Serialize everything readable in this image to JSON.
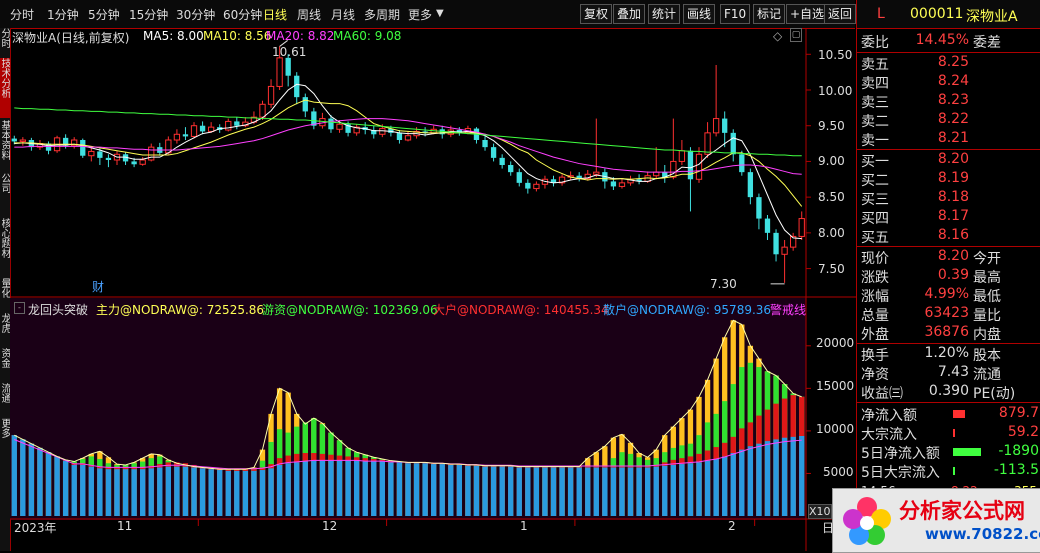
{
  "period_tabs": [
    "分时",
    "1分钟",
    "5分钟",
    "15分钟",
    "30分钟",
    "60分钟",
    "日线",
    "周线",
    "月线",
    "多周期",
    "更多"
  ],
  "active_period": "日线",
  "tools": [
    "复权",
    "叠加",
    "统计",
    "画线",
    "F10",
    "标记",
    "+自选",
    "返回"
  ],
  "left_tabs": [
    "分时",
    "技术分析",
    "基本资料",
    "公司",
    "核心题材",
    "量化",
    "龙虎",
    "资金",
    "流通",
    "更多"
  ],
  "chart_header": {
    "stock": "深物业A(日线,前复权)",
    "ma5": "MA5: 8.00",
    "ma10": "MA10: 8.56",
    "ma20": "MA20: 8.82",
    "ma60": "MA60: 9.08"
  },
  "annotations": {
    "high": "10.61",
    "low": "7.30",
    "cai": "财"
  },
  "indicator_header": {
    "name": "龙回头突破",
    "zhuli": "主力@NODRAW@: 72525.86",
    "youzi": "游资@NODRAW@: 102369.06",
    "dahu": "大户@NODRAW@: 140455.34",
    "sanhu": "散户@NODRAW@: 95789.36",
    "jingjie": "警戒线"
  },
  "price_axis": [
    "10.50",
    "10.00",
    "9.50",
    "9.00",
    "8.50",
    "8.00",
    "7.50"
  ],
  "vol_axis": [
    "20000",
    "15000",
    "10000",
    "5000"
  ],
  "x_axis": [
    "2023年",
    "11",
    "12",
    "1",
    "2"
  ],
  "x10": "X10",
  "ri": "日",
  "sidebar": {
    "code": "000011",
    "name": "深物业A",
    "flag": "L",
    "weibi_label": "委比",
    "weibi_value": "14.45%",
    "weicha_label": "委差",
    "sells": [
      {
        "label": "卖五",
        "price": "8.25"
      },
      {
        "label": "卖四",
        "price": "8.24"
      },
      {
        "label": "卖三",
        "price": "8.23"
      },
      {
        "label": "卖二",
        "price": "8.22"
      },
      {
        "label": "卖一",
        "price": "8.21"
      }
    ],
    "buys": [
      {
        "label": "买一",
        "price": "8.20"
      },
      {
        "label": "买二",
        "price": "8.19"
      },
      {
        "label": "买三",
        "price": "8.18"
      },
      {
        "label": "买四",
        "price": "8.17"
      },
      {
        "label": "买五",
        "price": "8.16"
      }
    ],
    "quote": [
      {
        "label": "现价",
        "value": "8.20",
        "label2": "今开"
      },
      {
        "label": "涨跌",
        "value": "0.39",
        "label2": "最高"
      },
      {
        "label": "涨幅",
        "value": "4.99%",
        "label2": "最低"
      },
      {
        "label": "总量",
        "value": "63423",
        "label2": "量比"
      },
      {
        "label": "外盘",
        "value": "36876",
        "label2": "内盘"
      }
    ],
    "stats": [
      {
        "label": "换手",
        "value": "1.20%",
        "label2": "股本"
      },
      {
        "label": "净资",
        "value": "7.43",
        "label2": "流通"
      },
      {
        "label": "收益㈢",
        "value": "0.390",
        "label2": "PE(动)"
      }
    ],
    "flows": [
      {
        "label": "净流入额",
        "value": "879.7"
      },
      {
        "label": "大宗流入",
        "value": "59.2"
      },
      {
        "label": "5日净流入额",
        "value": "-1890"
      },
      {
        "label": "5日大宗流入",
        "value": "-113.5"
      }
    ],
    "tick": {
      "time": "14:56",
      "price": "8.22",
      "vol": "355"
    }
  },
  "watermark": {
    "text": "分析家公式网",
    "url": "www.70822.com"
  },
  "chart_data": {
    "type": "candlestick",
    "price_ylim": [
      7.2,
      10.7
    ],
    "indicator_ylim": [
      0,
      23500
    ],
    "candles": [
      [
        9.32,
        9.28,
        9.36,
        9.24
      ],
      [
        9.28,
        9.3,
        9.34,
        9.22
      ],
      [
        9.3,
        9.2,
        9.33,
        9.15
      ],
      [
        9.2,
        9.25,
        9.3,
        9.16
      ],
      [
        9.25,
        9.15,
        9.28,
        9.1
      ],
      [
        9.15,
        9.33,
        9.36,
        9.12
      ],
      [
        9.33,
        9.22,
        9.38,
        9.18
      ],
      [
        9.22,
        9.3,
        9.34,
        9.18
      ],
      [
        9.3,
        9.08,
        9.32,
        9.05
      ],
      [
        9.08,
        9.14,
        9.2,
        9.0
      ],
      [
        9.14,
        9.05,
        9.18,
        8.95
      ],
      [
        9.05,
        9.02,
        9.1,
        8.92
      ],
      [
        9.02,
        9.1,
        9.15,
        8.95
      ],
      [
        9.1,
        9.0,
        9.13,
        8.95
      ],
      [
        9.0,
        8.96,
        9.05,
        8.92
      ],
      [
        8.96,
        9.02,
        9.06,
        8.94
      ],
      [
        9.02,
        9.2,
        9.25,
        9.0
      ],
      [
        9.2,
        9.12,
        9.26,
        9.08
      ],
      [
        9.12,
        9.3,
        9.35,
        9.1
      ],
      [
        9.3,
        9.38,
        9.45,
        9.25
      ],
      [
        9.38,
        9.35,
        9.48,
        9.3
      ],
      [
        9.35,
        9.5,
        9.55,
        9.32
      ],
      [
        9.5,
        9.42,
        9.56,
        9.38
      ],
      [
        9.42,
        9.48,
        9.55,
        9.4
      ],
      [
        9.48,
        9.44,
        9.52,
        9.4
      ],
      [
        9.44,
        9.56,
        9.6,
        9.42
      ],
      [
        9.56,
        9.5,
        9.62,
        9.45
      ],
      [
        9.5,
        9.55,
        9.62,
        9.48
      ],
      [
        9.55,
        9.62,
        9.7,
        9.52
      ],
      [
        9.62,
        9.8,
        9.85,
        9.58
      ],
      [
        9.8,
        10.05,
        10.15,
        9.75
      ],
      [
        10.05,
        10.45,
        10.61,
        10.0
      ],
      [
        10.45,
        10.2,
        10.5,
        10.05
      ],
      [
        10.2,
        9.9,
        10.25,
        9.8
      ],
      [
        9.9,
        9.7,
        9.95,
        9.62
      ],
      [
        9.7,
        9.5,
        9.75,
        9.45
      ],
      [
        9.5,
        9.6,
        9.68,
        9.46
      ],
      [
        9.6,
        9.45,
        9.65,
        9.4
      ],
      [
        9.45,
        9.52,
        9.58,
        9.4
      ],
      [
        9.52,
        9.4,
        9.56,
        9.35
      ],
      [
        9.4,
        9.48,
        9.52,
        9.36
      ],
      [
        9.48,
        9.44,
        9.55,
        9.38
      ],
      [
        9.44,
        9.38,
        9.5,
        9.32
      ],
      [
        9.38,
        9.46,
        9.52,
        9.34
      ],
      [
        9.46,
        9.4,
        9.5,
        9.35
      ],
      [
        9.4,
        9.3,
        9.44,
        9.25
      ],
      [
        9.3,
        9.36,
        9.42,
        9.28
      ],
      [
        9.36,
        9.42,
        9.48,
        9.32
      ],
      [
        9.42,
        9.4,
        9.48,
        9.35
      ],
      [
        9.4,
        9.45,
        9.5,
        9.38
      ],
      [
        9.45,
        9.38,
        9.5,
        9.32
      ],
      [
        9.38,
        9.44,
        9.5,
        9.34
      ],
      [
        9.44,
        9.4,
        9.48,
        9.36
      ],
      [
        9.4,
        9.46,
        9.5,
        9.38
      ],
      [
        9.46,
        9.3,
        9.48,
        9.25
      ],
      [
        9.3,
        9.2,
        9.35,
        9.15
      ],
      [
        9.2,
        9.05,
        9.25,
        9.0
      ],
      [
        9.05,
        8.95,
        9.1,
        8.9
      ],
      [
        8.95,
        8.85,
        9.0,
        8.8
      ],
      [
        8.85,
        8.7,
        8.9,
        8.65
      ],
      [
        8.7,
        8.62,
        8.75,
        8.55
      ],
      [
        8.62,
        8.68,
        8.72,
        8.58
      ],
      [
        8.68,
        8.75,
        8.8,
        8.62
      ],
      [
        8.75,
        8.7,
        8.8,
        8.65
      ],
      [
        8.7,
        8.78,
        8.82,
        8.66
      ],
      [
        8.78,
        8.8,
        8.86,
        8.74
      ],
      [
        8.8,
        8.76,
        8.85,
        8.72
      ],
      [
        8.76,
        8.82,
        8.88,
        8.73
      ],
      [
        8.82,
        8.85,
        9.6,
        8.78
      ],
      [
        8.85,
        8.72,
        8.9,
        8.62
      ],
      [
        8.72,
        8.65,
        8.78,
        8.6
      ],
      [
        8.65,
        8.7,
        8.76,
        8.62
      ],
      [
        8.7,
        8.75,
        8.8,
        8.66
      ],
      [
        8.75,
        8.72,
        8.82,
        8.68
      ],
      [
        8.72,
        8.8,
        8.86,
        8.7
      ],
      [
        8.8,
        8.85,
        9.2,
        8.76
      ],
      [
        8.85,
        8.78,
        8.95,
        8.7
      ],
      [
        8.78,
        9.0,
        9.6,
        8.75
      ],
      [
        9.0,
        9.15,
        9.3,
        8.95
      ],
      [
        9.15,
        8.75,
        9.2,
        8.3
      ],
      [
        8.75,
        9.1,
        9.2,
        8.7
      ],
      [
        9.1,
        9.4,
        9.55,
        9.05
      ],
      [
        9.4,
        9.6,
        10.35,
        9.35
      ],
      [
        9.6,
        9.4,
        9.7,
        9.2
      ],
      [
        9.4,
        9.1,
        9.45,
        9.0
      ],
      [
        9.1,
        8.85,
        9.15,
        8.8
      ],
      [
        8.85,
        8.5,
        8.9,
        8.4
      ],
      [
        8.5,
        8.2,
        8.55,
        8.05
      ],
      [
        8.2,
        8.0,
        8.25,
        7.9
      ],
      [
        8.0,
        7.7,
        8.05,
        7.6
      ],
      [
        7.7,
        7.8,
        7.9,
        7.3
      ],
      [
        7.8,
        7.95,
        8.0,
        7.75
      ],
      [
        7.95,
        8.2,
        8.3,
        7.9
      ]
    ],
    "ma5": [
      9.25,
      9.26,
      9.25,
      9.24,
      9.22,
      9.23,
      9.23,
      9.24,
      9.22,
      9.19,
      9.16,
      9.12,
      9.06,
      9.06,
      9.03,
      9.03,
      9.06,
      9.06,
      9.12,
      9.2,
      9.27,
      9.33,
      9.39,
      9.41,
      9.46,
      9.47,
      9.49,
      9.51,
      9.55,
      9.61,
      9.71,
      9.86,
      10.0,
      10.08,
      10.06,
      9.95,
      9.78,
      9.63,
      9.55,
      9.5,
      9.47,
      9.46,
      9.43,
      9.43,
      9.42,
      9.4,
      9.39,
      9.39,
      9.37,
      9.39,
      9.4,
      9.42,
      9.41,
      9.42,
      9.4,
      9.36,
      9.29,
      9.19,
      9.07,
      8.95,
      8.83,
      8.76,
      8.72,
      8.7,
      8.71,
      8.74,
      8.76,
      8.77,
      8.81,
      8.79,
      8.76,
      8.76,
      8.74,
      8.72,
      8.72,
      8.76,
      8.78,
      8.83,
      8.92,
      8.91,
      8.96,
      9.08,
      9.16,
      9.25,
      9.33,
      9.29,
      9.09,
      8.81,
      8.53,
      8.25,
      8.04,
      7.93,
      7.92
    ],
    "ma10": [
      9.26,
      9.26,
      9.26,
      9.25,
      9.24,
      9.24,
      9.24,
      9.24,
      9.23,
      9.21,
      9.19,
      9.17,
      9.15,
      9.13,
      9.11,
      9.09,
      9.09,
      9.09,
      9.09,
      9.11,
      9.15,
      9.19,
      9.23,
      9.27,
      9.32,
      9.37,
      9.41,
      9.45,
      9.48,
      9.53,
      9.59,
      9.67,
      9.75,
      9.81,
      9.86,
      9.83,
      9.82,
      9.81,
      9.81,
      9.78,
      9.71,
      9.62,
      9.53,
      9.49,
      9.46,
      9.43,
      9.42,
      9.41,
      9.4,
      9.4,
      9.4,
      9.4,
      9.4,
      9.4,
      9.4,
      9.38,
      9.35,
      9.3,
      9.24,
      9.17,
      9.12,
      9.02,
      8.95,
      8.88,
      8.83,
      8.78,
      8.76,
      8.74,
      8.76,
      8.76,
      8.75,
      8.76,
      8.75,
      8.76,
      8.77,
      8.76,
      8.77,
      8.79,
      8.82,
      8.82,
      8.86,
      8.92,
      8.99,
      9.05,
      9.12,
      9.12,
      9.08,
      9.0,
      8.89,
      8.79,
      8.67,
      8.52,
      8.37
    ],
    "ma20": [
      9.2,
      9.2,
      9.21,
      9.21,
      9.21,
      9.21,
      9.21,
      9.21,
      9.21,
      9.2,
      9.2,
      9.19,
      9.19,
      9.18,
      9.17,
      9.17,
      9.16,
      9.16,
      9.16,
      9.16,
      9.17,
      9.18,
      9.19,
      9.2,
      9.21,
      9.23,
      9.25,
      9.27,
      9.29,
      9.32,
      9.36,
      9.4,
      9.44,
      9.47,
      9.5,
      9.52,
      9.54,
      9.56,
      9.57,
      9.58,
      9.59,
      9.6,
      9.6,
      9.6,
      9.59,
      9.58,
      9.57,
      9.55,
      9.53,
      9.51,
      9.49,
      9.47,
      9.45,
      9.43,
      9.41,
      9.38,
      9.35,
      9.31,
      9.27,
      9.22,
      9.18,
      9.14,
      9.1,
      9.06,
      9.03,
      9.0,
      8.97,
      8.95,
      8.93,
      8.91,
      8.89,
      8.88,
      8.87,
      8.86,
      8.85,
      8.85,
      8.85,
      8.85,
      8.86,
      8.86,
      8.87,
      8.88,
      8.9,
      8.92,
      8.94,
      8.95,
      8.95,
      8.94,
      8.92,
      8.89,
      8.86,
      8.83,
      8.82
    ],
    "ma60": [
      9.75,
      9.74,
      9.74,
      9.73,
      9.73,
      9.72,
      9.72,
      9.71,
      9.71,
      9.7,
      9.7,
      9.69,
      9.69,
      9.68,
      9.68,
      9.67,
      9.67,
      9.66,
      9.66,
      9.65,
      9.65,
      9.64,
      9.64,
      9.63,
      9.63,
      9.62,
      9.62,
      9.61,
      9.61,
      9.6,
      9.6,
      9.59,
      9.59,
      9.58,
      9.58,
      9.57,
      9.56,
      9.55,
      9.54,
      9.53,
      9.52,
      9.51,
      9.5,
      9.49,
      9.48,
      9.47,
      9.46,
      9.45,
      9.44,
      9.43,
      9.42,
      9.41,
      9.4,
      9.39,
      9.38,
      9.37,
      9.36,
      9.35,
      9.34,
      9.33,
      9.32,
      9.31,
      9.3,
      9.29,
      9.28,
      9.27,
      9.26,
      9.25,
      9.24,
      9.23,
      9.22,
      9.21,
      9.2,
      9.19,
      9.18,
      9.17,
      9.16,
      9.16,
      9.15,
      9.14,
      9.14,
      9.13,
      9.13,
      9.12,
      9.12,
      9.11,
      9.11,
      9.1,
      9.1,
      9.09,
      9.09,
      9.08,
      9.08
    ],
    "blue": [
      9500,
      9000,
      8500,
      8000,
      7500,
      7000,
      6500,
      6000,
      6000,
      5800,
      5600,
      5500,
      5500,
      5500,
      5500,
      5500,
      5600,
      5700,
      5800,
      5800,
      5800,
      5700,
      5600,
      5500,
      5400,
      5300,
      5300,
      5300,
      5300,
      5400,
      5600,
      6000,
      6200,
      6300,
      6400,
      6500,
      6500,
      6500,
      6500,
      6500,
      6500,
      6400,
      6400,
      6400,
      6300,
      6300,
      6200,
      6200,
      6200,
      6100,
      6100,
      6000,
      6000,
      5900,
      5900,
      5800,
      5800,
      5800,
      5800,
      5700,
      5700,
      5700,
      5700,
      5700,
      5700,
      5700,
      5700,
      5700,
      5700,
      5700,
      5700,
      5700,
      5700,
      5700,
      5700,
      5800,
      5900,
      6000,
      6100,
      6200,
      6300,
      6500,
      6700,
      7000,
      7400,
      7800,
      8200,
      8500,
      8800,
      9000,
      9200,
      9300,
      9400
    ],
    "red": [
      9500,
      9000,
      8500,
      8000,
      7500,
      7000,
      6600,
      6200,
      6200,
      6000,
      5800,
      5700,
      5700,
      5700,
      5700,
      5700,
      5900,
      6100,
      6300,
      6300,
      6200,
      6000,
      5800,
      5700,
      5600,
      5500,
      5500,
      5500,
      5500,
      5700,
      6100,
      6800,
      7100,
      7300,
      7400,
      7400,
      7300,
      7200,
      7100,
      7000,
      6900,
      6800,
      6700,
      6600,
      6500,
      6400,
      6300,
      6300,
      6300,
      6200,
      6200,
      6100,
      6100,
      6000,
      6000,
      5900,
      5900,
      5900,
      5900,
      5800,
      5800,
      5800,
      5800,
      5800,
      5800,
      5800,
      5800,
      5800,
      5800,
      5800,
      5800,
      5800,
      5800,
      5800,
      5800,
      6000,
      6300,
      6600,
      6800,
      7000,
      7300,
      7700,
      8100,
      8600,
      9300,
      10300,
      11000,
      11800,
      12500,
      13200,
      13800,
      14200,
      14000
    ],
    "green": [
      9500,
      9000,
      8500,
      8000,
      7500,
      7000,
      6600,
      6400,
      6700,
      7000,
      6700,
      6200,
      6000,
      6000,
      6200,
      6400,
      6800,
      7000,
      6500,
      6200,
      6000,
      5800,
      5700,
      5600,
      5500,
      5500,
      5500,
      5500,
      5600,
      6500,
      8700,
      10200,
      9800,
      10500,
      11000,
      11500,
      10800,
      9800,
      8900,
      8000,
      7500,
      7200,
      6900,
      6700,
      6500,
      6400,
      6300,
      6300,
      6300,
      6200,
      6200,
      6100,
      6100,
      6000,
      6000,
      5900,
      5900,
      5900,
      5900,
      5800,
      5800,
      5800,
      5800,
      5800,
      5800,
      5800,
      5800,
      5800,
      5800,
      5800,
      6800,
      7500,
      7300,
      6900,
      6600,
      6800,
      7500,
      8000,
      8300,
      8500,
      9500,
      11000,
      12000,
      13500,
      15500,
      17500,
      18000,
      17500,
      17000,
      16500,
      15500,
      14400,
      14000
    ],
    "yellow": [
      9500,
      9000,
      8500,
      8000,
      7500,
      7000,
      6600,
      6400,
      6800,
      7300,
      7600,
      6900,
      6100,
      6000,
      6300,
      6800,
      7300,
      7200,
      6600,
      6200,
      6000,
      5800,
      5700,
      5600,
      5500,
      5500,
      5500,
      5500,
      5700,
      7800,
      12000,
      15000,
      14500,
      12000,
      10800,
      11500,
      10900,
      9800,
      8900,
      8000,
      7500,
      7200,
      6900,
      6700,
      6500,
      6400,
      6300,
      6300,
      6300,
      6200,
      6200,
      6100,
      6100,
      6000,
      6000,
      5900,
      5900,
      5900,
      5900,
      5800,
      5800,
      5800,
      5800,
      5800,
      5800,
      5800,
      5800,
      6800,
      7500,
      8200,
      9200,
      9600,
      8600,
      7400,
      6900,
      7800,
      9500,
      10500,
      11500,
      12500,
      14000,
      16000,
      18500,
      21000,
      23000,
      22500,
      20000,
      18500,
      17000,
      16500,
      15500,
      14400,
      14000
    ]
  }
}
